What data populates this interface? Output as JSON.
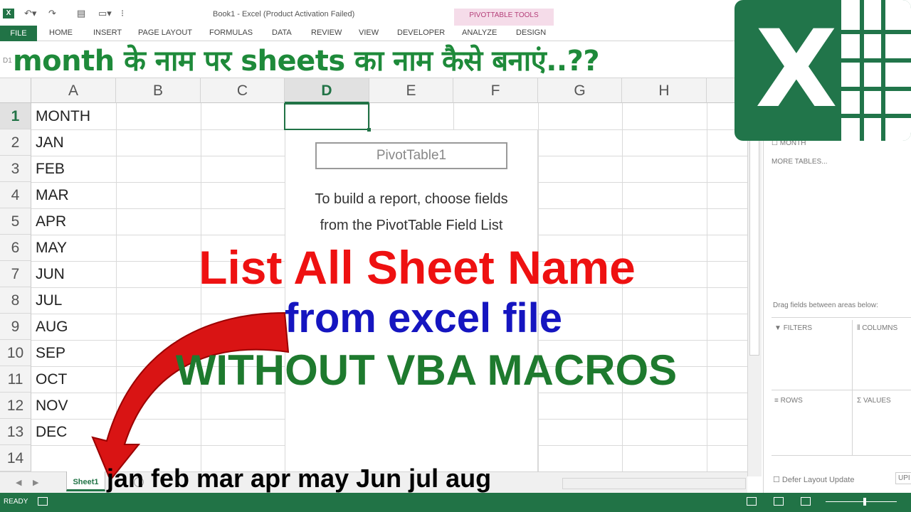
{
  "titlebar": {
    "window_title": "Book1 - Excel (Product Activation Failed)",
    "pivot_tools": "PIVOTTABLE TOOLS"
  },
  "ribbon": {
    "file": "FILE",
    "tabs": [
      "HOME",
      "INSERT",
      "PAGE LAYOUT",
      "FORMULAS",
      "DATA",
      "REVIEW",
      "VIEW",
      "DEVELOPER",
      "ANALYZE",
      "DESIGN"
    ]
  },
  "namebox": {
    "value": "D1"
  },
  "heading_hindi": "month के नाम पर sheets का नाम कैसे बनाएं..??",
  "grid": {
    "columns": [
      "A",
      "B",
      "C",
      "D",
      "E",
      "F",
      "G",
      "H"
    ],
    "active_column": "D",
    "rows": [
      "1",
      "2",
      "3",
      "4",
      "5",
      "6",
      "7",
      "8",
      "9",
      "10",
      "11",
      "12",
      "13",
      "14"
    ],
    "active_row": "1",
    "column_a": [
      "MONTH",
      "JAN",
      "FEB",
      "MAR",
      "APR",
      "MAY",
      "JUN",
      "JUL",
      "AUG",
      "SEP",
      "OCT",
      "NOV",
      "DEC",
      ""
    ]
  },
  "pivot": {
    "name": "PivotTable1",
    "hint_line1": "To build a report, choose fields",
    "hint_line2": "from the PivotTable Field List"
  },
  "field_pane": {
    "field_month": "MONTH",
    "more_tables": "MORE TABLES...",
    "drag_hint": "Drag fields between areas below:",
    "filters": "FILTERS",
    "columns": "COLUMNS",
    "rows": "ROWS",
    "values": "VALUES",
    "defer": "Defer Layout Update",
    "update": "UPI"
  },
  "overlay": {
    "line1": "List All Sheet Name",
    "line2": "from excel file",
    "line3": "WITHOUT VBA MACROS",
    "months": "jan feb mar apr may Jun jul aug"
  },
  "sheet_tabs": {
    "active": "Sheet1"
  },
  "status": {
    "ready": "READY"
  },
  "colors": {
    "excel_green": "#217346",
    "headline_red": "#ee1111",
    "headline_blue": "#1515c0",
    "headline_green": "#1e7a2e",
    "hindi_green": "#1e8a3a"
  },
  "icons": [
    "excel-logo-icon",
    "undo-icon",
    "redo-icon",
    "save-icon",
    "arrow-icon",
    "filter-icon",
    "columns-icon",
    "rows-icon",
    "sigma-icon"
  ]
}
